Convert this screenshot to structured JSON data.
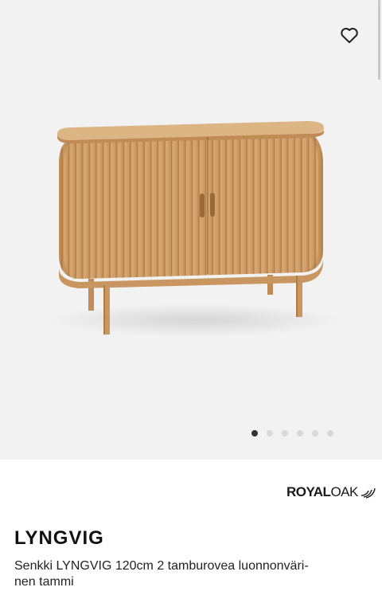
{
  "gallery": {
    "image_alt": "LYNGVIG sideboard",
    "dot_count": 6,
    "active_index": 0,
    "favorite_icon": "heart-outline-icon",
    "background": "#f2f2f2"
  },
  "brand": {
    "part1": "ROYAL",
    "part2": "OAK"
  },
  "product": {
    "name": "LYNGVIG",
    "description_line1": "Senkki LYNGVIG 120cm 2 tamburovea luonnonväri-",
    "description_line2": "nen tammi"
  }
}
